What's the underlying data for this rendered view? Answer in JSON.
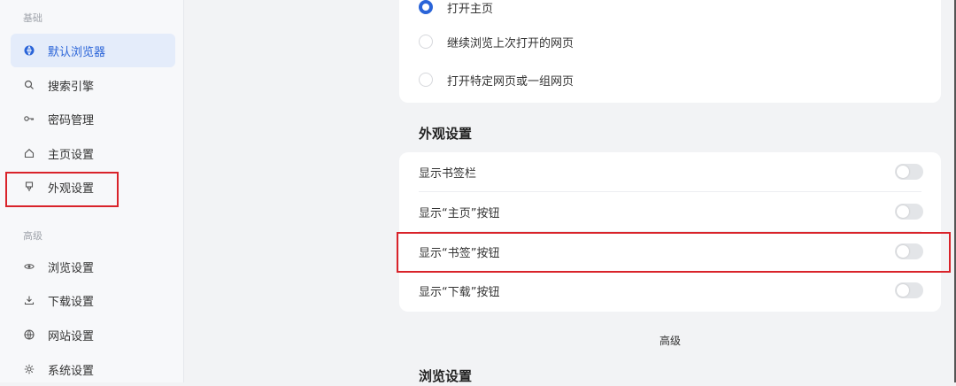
{
  "sidebar": {
    "section_basic": "基础",
    "section_advanced": "高级",
    "items": [
      {
        "label": "默认浏览器",
        "icon": "globe-filled-icon",
        "active": true
      },
      {
        "label": "搜索引擎",
        "icon": "search-icon"
      },
      {
        "label": "密码管理",
        "icon": "key-icon"
      },
      {
        "label": "主页设置",
        "icon": "home-icon"
      },
      {
        "label": "外观设置",
        "icon": "brush-icon"
      },
      {
        "label": "浏览设置",
        "icon": "eye-icon"
      },
      {
        "label": "下载设置",
        "icon": "download-icon"
      },
      {
        "label": "网站设置",
        "icon": "globe-icon"
      },
      {
        "label": "系统设置",
        "icon": "gear-icon"
      }
    ]
  },
  "startup": {
    "options": [
      {
        "label": "打开主页",
        "checked": true
      },
      {
        "label": "继续浏览上次打开的网页",
        "checked": false
      },
      {
        "label": "打开特定网页或一组网页",
        "checked": false
      }
    ]
  },
  "appearance": {
    "title": "外观设置",
    "toggles": [
      {
        "label": "显示书签栏",
        "on": false
      },
      {
        "label": "显示“主页”按钮",
        "on": false
      },
      {
        "label": "显示“书签”按钮",
        "on": false
      },
      {
        "label": "显示“下载”按钮",
        "on": false
      }
    ]
  },
  "advanced_label": "高级",
  "browse_title": "浏览设置",
  "colors": {
    "accent": "#2a64d8",
    "highlight": "#d9232a"
  }
}
